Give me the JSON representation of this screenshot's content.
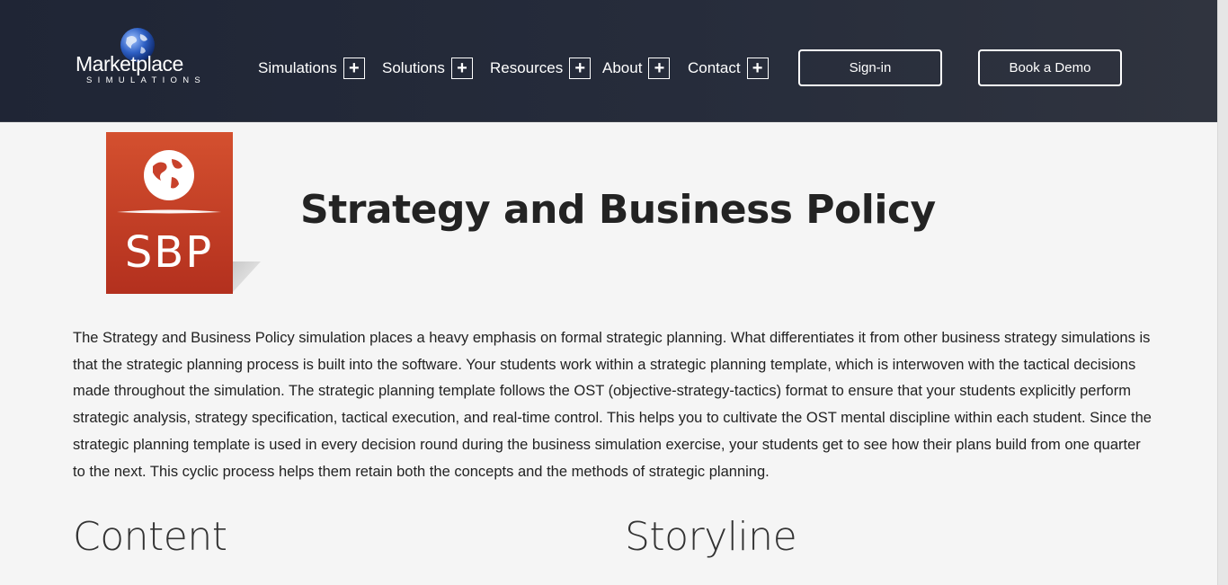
{
  "header": {
    "logo": {
      "wordmark": "Marketplace",
      "tagline": "SIMULATIONS",
      "globe_icon": "globe-icon"
    },
    "nav": [
      {
        "label": "Simulations",
        "icon": "plus-icon"
      },
      {
        "label": "Solutions",
        "icon": "plus-icon"
      },
      {
        "label": "Resources",
        "icon": "plus-icon"
      },
      {
        "label": "About",
        "icon": "plus-icon"
      },
      {
        "label": "Contact",
        "icon": "plus-icon"
      }
    ],
    "signin_label": "Sign-in",
    "demo_label": "Book a Demo"
  },
  "product": {
    "badge_text": "SBP",
    "badge_icon": "globe-icon",
    "badge_color": "#c8412b",
    "title": "Strategy and Business Policy"
  },
  "intro": "The Strategy and Business Policy simulation places a heavy emphasis on formal strategic planning. What differentiates it from other business strategy simulations is that the strategic planning process is built into the software. Your students work within a strategic planning template, which is interwoven with the tactical decisions made throughout the simulation. The strategic planning template follows the OST (objective-strategy-tactics) format to ensure that your students explicitly perform strategic analysis, strategy specification, tactical execution, and real-time control. This helps you to cultivate the OST mental discipline within each student. Since the strategic planning template is used in every decision round during the business simulation exercise, your students get to see how their plans build from one quarter to the next. This cyclic process helps them retain both the concepts and the methods of strategic planning.",
  "sections": {
    "content_title": "Content",
    "storyline_title": "Storyline"
  },
  "colors": {
    "header_bg": "#232938",
    "page_bg": "#f5f5f5",
    "accent": "#c8412b"
  }
}
